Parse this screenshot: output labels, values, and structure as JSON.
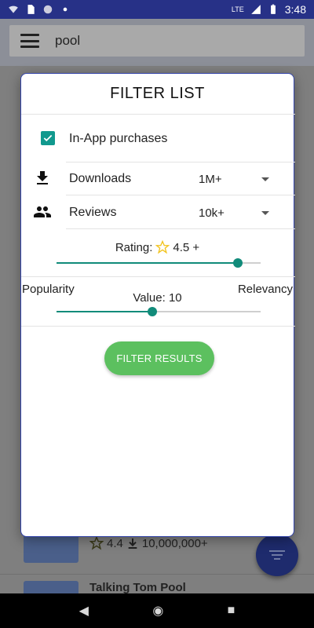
{
  "status_bar": {
    "time": "3:48",
    "network": "LTE"
  },
  "search": {
    "query": "pool"
  },
  "background_list": {
    "items": [
      {
        "rating": "4.4",
        "downloads": "10,000,000+"
      },
      {
        "title": "Talking Tom Pool"
      }
    ]
  },
  "dialog": {
    "title": "FILTER LIST",
    "in_app": {
      "label": "In-App purchases",
      "checked": true
    },
    "downloads": {
      "label": "Downloads",
      "value": "1M+"
    },
    "reviews": {
      "label": "Reviews",
      "value": "10k+"
    },
    "rating": {
      "label": "Rating:",
      "value": "4.5 +",
      "slider_fraction": 0.89
    },
    "balance": {
      "left_label": "Popularity",
      "right_label": "Relevancy",
      "value_label": "Value: 10",
      "slider_fraction": 0.47
    },
    "filter_button": "FILTER RESULTS"
  },
  "navbar": {
    "back": "◀",
    "home": "◉",
    "recents": "■"
  },
  "colors": {
    "accent": "#118b7a",
    "button": "#5cc05f",
    "statusbar": "#273187",
    "fab": "#1e2b6d"
  },
  "icons": [
    "download-icon",
    "people-icon",
    "star-outline-icon",
    "check-icon",
    "menu-icon",
    "filter-icon"
  ]
}
